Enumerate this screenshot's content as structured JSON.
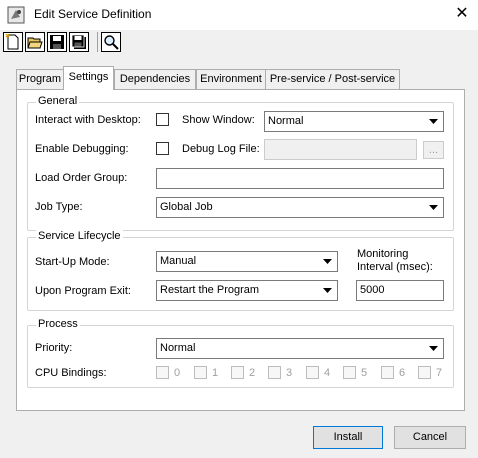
{
  "window": {
    "title": "Edit Service Definition",
    "close_glyph": "✕"
  },
  "toolbar": {
    "buttons": [
      {
        "name": "new-icon"
      },
      {
        "name": "open-folder-icon"
      },
      {
        "name": "save-icon"
      },
      {
        "name": "save-as-icon"
      },
      {
        "name": "search-icon"
      }
    ]
  },
  "tabs": [
    {
      "label": "Program",
      "active": false
    },
    {
      "label": "Settings",
      "active": true
    },
    {
      "label": "Dependencies",
      "active": false
    },
    {
      "label": "Environment",
      "active": false
    },
    {
      "label": "Pre-service / Post-service",
      "active": false
    }
  ],
  "general": {
    "label": "General",
    "interact_desktop_label": "Interact with Desktop:",
    "interact_desktop_checked": false,
    "show_window_label": "Show Window:",
    "show_window_value": "Normal",
    "enable_debugging_label": "Enable Debugging:",
    "enable_debugging_checked": false,
    "debug_log_label": "Debug Log File:",
    "debug_log_value": "",
    "browse_label": "...",
    "load_order_label": "Load Order Group:",
    "load_order_value": "",
    "job_type_label": "Job Type:",
    "job_type_value": "Global Job"
  },
  "lifecycle": {
    "label": "Service Lifecycle",
    "startup_label": "Start-Up Mode:",
    "startup_value": "Manual",
    "exit_label": "Upon Program Exit:",
    "exit_value": "Restart the Program",
    "monitoring_label_line1": "Monitoring",
    "monitoring_label_line2": "Interval (msec):",
    "monitoring_value": "5000"
  },
  "process": {
    "label": "Process",
    "priority_label": "Priority:",
    "priority_value": "Normal",
    "cpu_label": "CPU Bindings:",
    "cpus": [
      "0",
      "1",
      "2",
      "3",
      "4",
      "5",
      "6",
      "7"
    ]
  },
  "footer": {
    "install_label": "Install",
    "cancel_label": "Cancel"
  }
}
